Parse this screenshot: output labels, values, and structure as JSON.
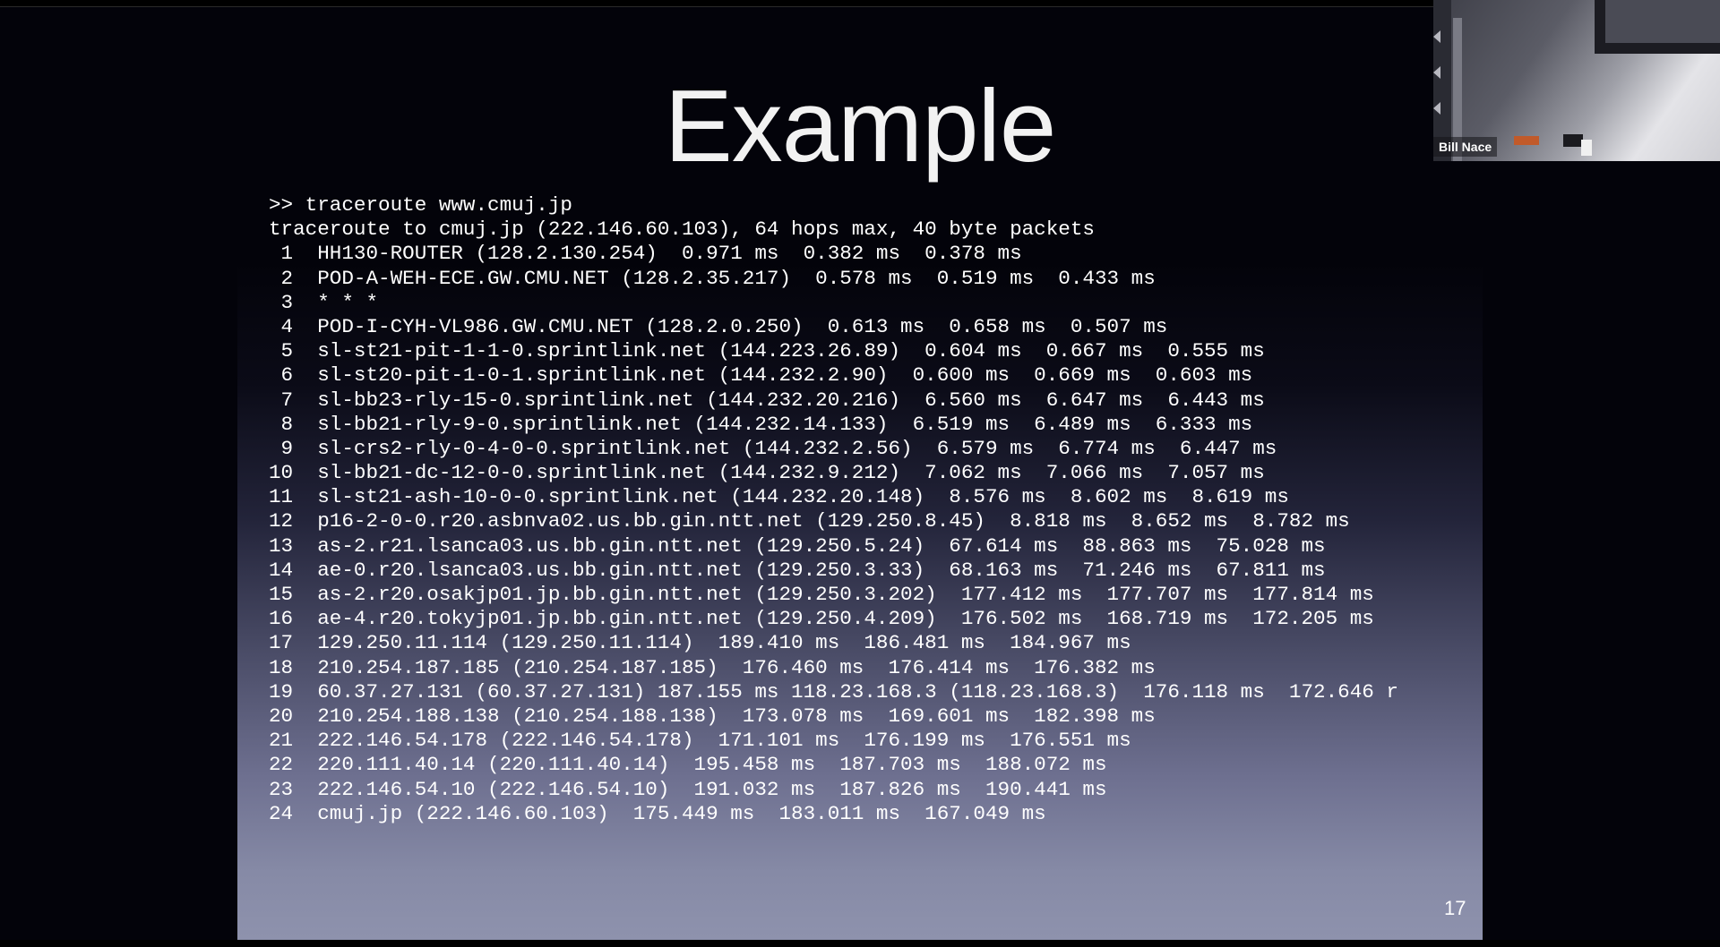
{
  "slide": {
    "title": "Example",
    "page_number": "17",
    "terminal_lines": [
      ">> traceroute www.cmuj.jp",
      "traceroute to cmuj.jp (222.146.60.103), 64 hops max, 40 byte packets",
      " 1  HH130-ROUTER (128.2.130.254)  0.971 ms  0.382 ms  0.378 ms",
      " 2  POD-A-WEH-ECE.GW.CMU.NET (128.2.35.217)  0.578 ms  0.519 ms  0.433 ms",
      " 3  * * *",
      " 4  POD-I-CYH-VL986.GW.CMU.NET (128.2.0.250)  0.613 ms  0.658 ms  0.507 ms",
      " 5  sl-st21-pit-1-1-0.sprintlink.net (144.223.26.89)  0.604 ms  0.667 ms  0.555 ms",
      " 6  sl-st20-pit-1-0-1.sprintlink.net (144.232.2.90)  0.600 ms  0.669 ms  0.603 ms",
      " 7  sl-bb23-rly-15-0.sprintlink.net (144.232.20.216)  6.560 ms  6.647 ms  6.443 ms",
      " 8  sl-bb21-rly-9-0.sprintlink.net (144.232.14.133)  6.519 ms  6.489 ms  6.333 ms",
      " 9  sl-crs2-rly-0-4-0-0.sprintlink.net (144.232.2.56)  6.579 ms  6.774 ms  6.447 ms",
      "10  sl-bb21-dc-12-0-0.sprintlink.net (144.232.9.212)  7.062 ms  7.066 ms  7.057 ms",
      "11  sl-st21-ash-10-0-0.sprintlink.net (144.232.20.148)  8.576 ms  8.602 ms  8.619 ms",
      "12  p16-2-0-0.r20.asbnva02.us.bb.gin.ntt.net (129.250.8.45)  8.818 ms  8.652 ms  8.782 ms",
      "13  as-2.r21.lsanca03.us.bb.gin.ntt.net (129.250.5.24)  67.614 ms  88.863 ms  75.028 ms",
      "14  ae-0.r20.lsanca03.us.bb.gin.ntt.net (129.250.3.33)  68.163 ms  71.246 ms  67.811 ms",
      "15  as-2.r20.osakjp01.jp.bb.gin.ntt.net (129.250.3.202)  177.412 ms  177.707 ms  177.814 ms",
      "16  ae-4.r20.tokyjp01.jp.bb.gin.ntt.net (129.250.4.209)  176.502 ms  168.719 ms  172.205 ms",
      "17  129.250.11.114 (129.250.11.114)  189.410 ms  186.481 ms  184.967 ms",
      "18  210.254.187.185 (210.254.187.185)  176.460 ms  176.414 ms  176.382 ms",
      "19  60.37.27.131 (60.37.27.131) 187.155 ms 118.23.168.3 (118.23.168.3)  176.118 ms  172.646 r",
      "20  210.254.188.138 (210.254.188.138)  173.078 ms  169.601 ms  182.398 ms",
      "21  222.146.54.178 (222.146.54.178)  171.101 ms  176.199 ms  176.551 ms",
      "22  220.111.40.14 (220.111.40.14)  195.458 ms  187.703 ms  188.072 ms",
      "23  222.146.54.10 (222.146.54.10)  191.032 ms  187.826 ms  190.441 ms",
      "24  cmuj.jp (222.146.60.103)  175.449 ms  183.011 ms  167.049 ms"
    ]
  },
  "video": {
    "participant_name": "Bill Nace"
  },
  "colors": {
    "slide_background": "#03030a",
    "slide_text": "#ffffff",
    "title_text": "#f2f2f2"
  }
}
